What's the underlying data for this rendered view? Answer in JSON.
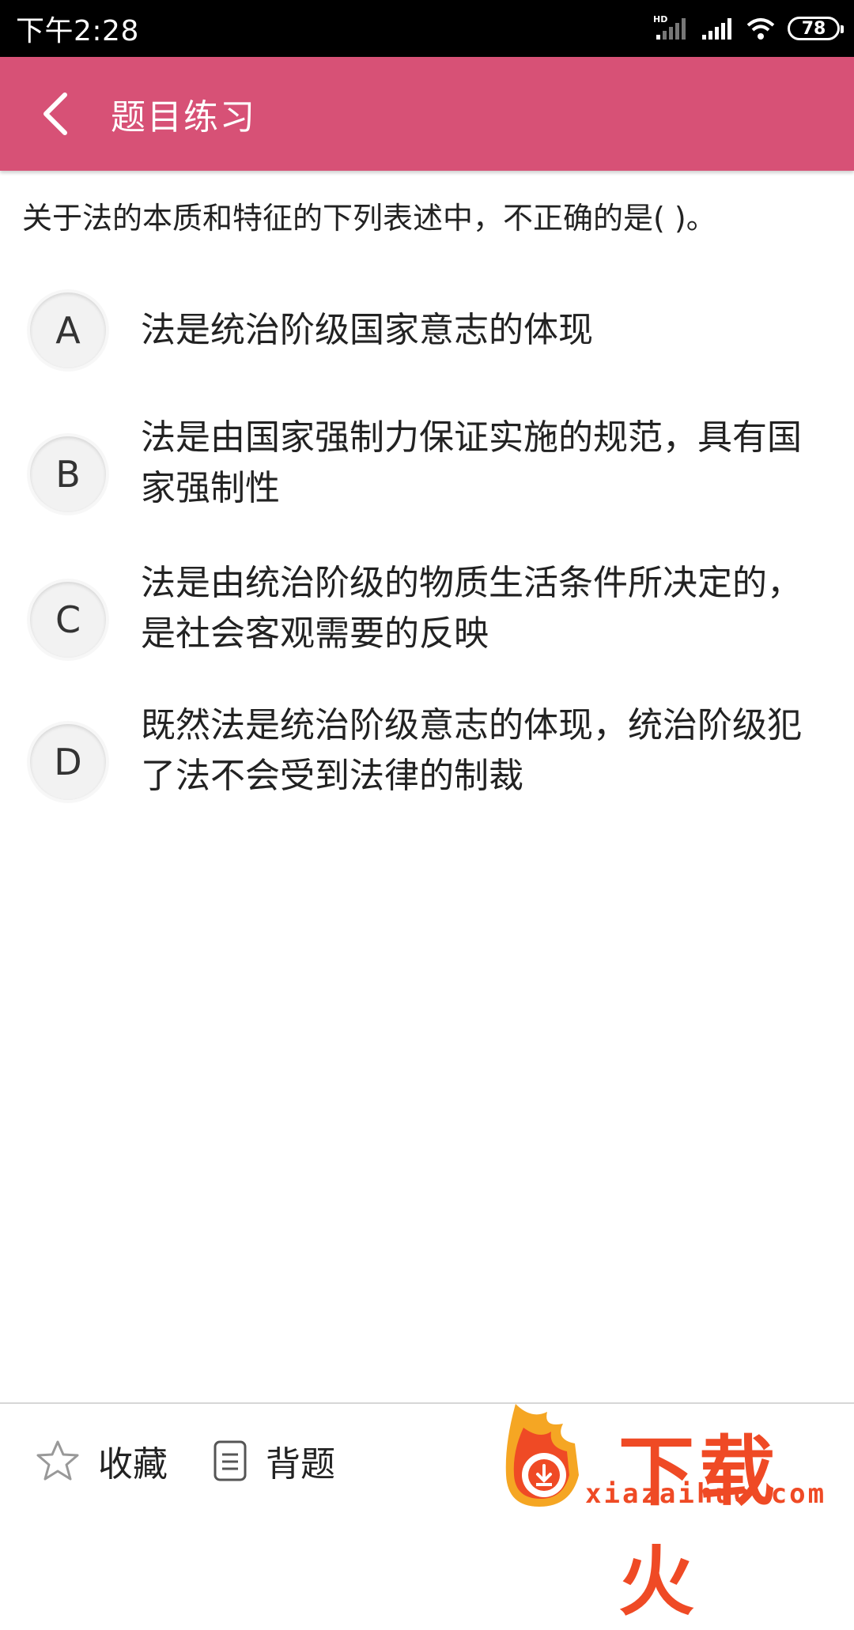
{
  "status_bar": {
    "time": "下午2:28",
    "network_label": "HD",
    "battery": "78"
  },
  "app_bar": {
    "title": "题目练习",
    "back_icon": "chevron-left-icon"
  },
  "question": {
    "text": "关于法的本质和特征的下列表述中，不正确的是( )。"
  },
  "options": [
    {
      "letter": "A",
      "text": "法是统治阶级国家意志的体现"
    },
    {
      "letter": "B",
      "text": "法是由国家强制力保证实施的规范，具有国家强制性"
    },
    {
      "letter": "C",
      "text": "法是由统治阶级的物质生活条件所决定的，是社会客观需要的反映"
    },
    {
      "letter": "D",
      "text": "既然法是统治阶级意志的体现，统治阶级犯了法不会受到法律的制裁"
    }
  ],
  "bottom_bar": {
    "favorite_label": "收藏",
    "favorite_icon": "star-outline-icon",
    "recite_label": "背题",
    "recite_icon": "document-icon"
  },
  "watermark": {
    "brand": "下载火",
    "domain": "xiazaihuo.com"
  },
  "colors": {
    "app_bar": "#d75176",
    "status_bar": "#000000",
    "option_circle": "#f2f2f2",
    "watermark": "#ef4a25"
  }
}
